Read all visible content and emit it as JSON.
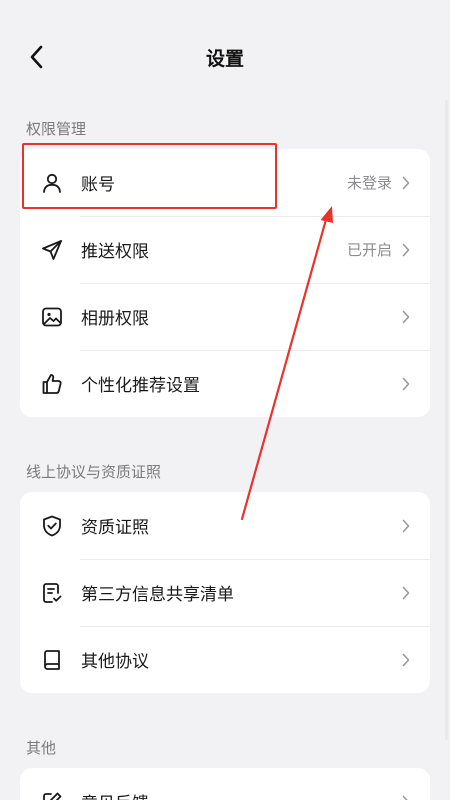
{
  "header": {
    "title": "设置"
  },
  "sections": [
    {
      "label": "权限管理",
      "items": [
        {
          "label": "账号",
          "value": "未登录"
        },
        {
          "label": "推送权限",
          "value": "已开启"
        },
        {
          "label": "相册权限",
          "value": ""
        },
        {
          "label": "个性化推荐设置",
          "value": ""
        }
      ]
    },
    {
      "label": "线上协议与资质证照",
      "items": [
        {
          "label": "资质证照",
          "value": ""
        },
        {
          "label": "第三方信息共享清单",
          "value": ""
        },
        {
          "label": "其他协议",
          "value": ""
        }
      ]
    },
    {
      "label": "其他",
      "items": [
        {
          "label": "意见反馈",
          "value": ""
        }
      ]
    }
  ],
  "colors": {
    "background": "#f2f2f4",
    "card": "#ffffff",
    "highlight": "#e8322c",
    "secondary_text": "#8c8c90"
  },
  "icons": {
    "back": "chevron-left-icon",
    "account": "person-icon",
    "push": "paper-plane-icon",
    "album": "image-icon",
    "personalize": "thumbs-up-icon",
    "license": "shield-check-icon",
    "third_party": "document-check-icon",
    "other_agreements": "book-icon",
    "feedback": "edit-icon",
    "chevron": "chevron-right-icon"
  }
}
